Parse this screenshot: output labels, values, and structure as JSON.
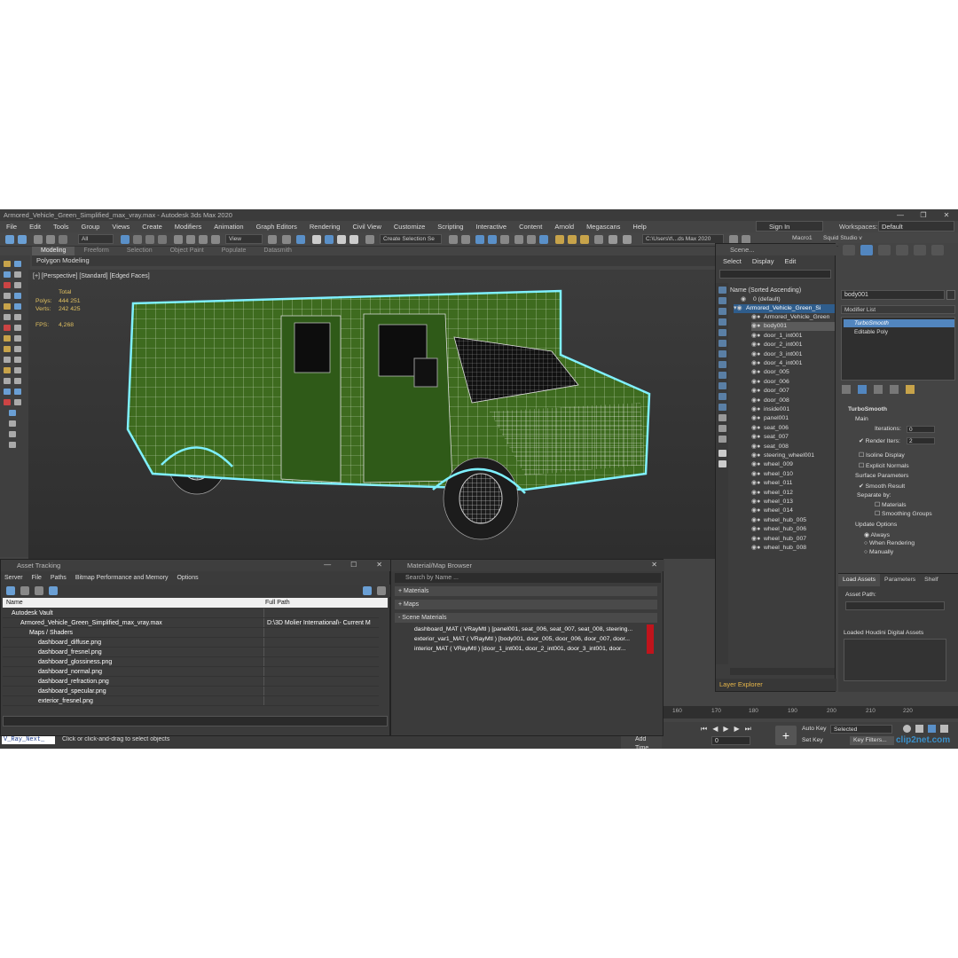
{
  "app": {
    "title": "Armored_Vehicle_Green_Simplified_max_vray.max - Autodesk 3ds Max 2020",
    "menu": [
      "File",
      "Edit",
      "Tools",
      "Group",
      "Views",
      "Create",
      "Modifiers",
      "Animation",
      "Graph Editors",
      "Rendering",
      "Civil View",
      "Customize",
      "Scripting",
      "Interactive",
      "Content",
      "Arnold",
      "Megascans",
      "Help"
    ],
    "sign_in": "Sign In",
    "workspaces_label": "Workspaces:",
    "workspaces_value": "Default",
    "toolbar": {
      "filter": "All",
      "ref_coord": "View",
      "selection_set": "Create Selection Se",
      "path": "C:\\Users\\t\\...ds Max 2020",
      "macro": "Macro1",
      "squid": "Squid Studio v"
    },
    "ribbon_tabs": [
      "Modeling",
      "Freeform",
      "Selection",
      "Object Paint",
      "Populate",
      "Datasmith"
    ],
    "ribbon_sub": "Polygon Modeling"
  },
  "viewport": {
    "label": "[+] [Perspective] [Standard] [Edged Faces]",
    "total": "Total",
    "polys_label": "Polys:",
    "polys_value": "444 251",
    "verts_label": "Verts:",
    "verts_value": "242 425",
    "fps_label": "FPS:",
    "fps_value": "4,268"
  },
  "scene_explorer": {
    "title": "Scene...",
    "menu": [
      "Select",
      "Display",
      "Edit"
    ],
    "column_header": "Name (Sorted Ascending)",
    "root": "0 (default)",
    "group": "Armored_Vehicle_Green_Si",
    "items": [
      "Armored_Vehicle_Green",
      "body001",
      "door_1_int001",
      "door_2_int001",
      "door_3_int001",
      "door_4_int001",
      "door_005",
      "door_006",
      "door_007",
      "door_008",
      "inside001",
      "panel001",
      "seat_006",
      "seat_007",
      "seat_008",
      "steering_wheel001",
      "wheel_009",
      "wheel_010",
      "wheel_011",
      "wheel_012",
      "wheel_013",
      "wheel_014",
      "wheel_hub_005",
      "wheel_hub_006",
      "wheel_hub_007",
      "wheel_hub_008"
    ],
    "footer": "Layer Explorer"
  },
  "command_panel": {
    "object_name": "body001",
    "modifier_list": "Modifier List",
    "stack": [
      "TurboSmooth",
      "Editable Poly"
    ],
    "rollout_title": "TurboSmooth",
    "main": "Main",
    "iterations_label": "Iterations:",
    "iterations_value": "0",
    "render_iters_label": "Render Iters:",
    "render_iters_value": "2",
    "isoline": "Isoline Display",
    "explicit": "Explicit Normals",
    "surface_params": "Surface Parameters",
    "smooth_result": "Smooth Result",
    "separate_by": "Separate by:",
    "materials": "Materials",
    "smoothing_groups": "Smoothing Groups",
    "update_options": "Update Options",
    "always": "Always",
    "when_rendering": "When Rendering",
    "manually": "Manually"
  },
  "bottom_panel": {
    "tabs": [
      "Load Assets",
      "Parameters",
      "Shelf"
    ],
    "asset_path": "Asset Path:",
    "loaded": "Loaded Houdini Digital Assets"
  },
  "asset_tracking": {
    "title": "Asset Tracking",
    "menu": [
      "Server",
      "File",
      "Paths",
      "Bitmap Performance and Memory",
      "Options"
    ],
    "col_name": "Name",
    "col_path": "Full Path",
    "rows": [
      {
        "name": "Autodesk Vault",
        "path": "",
        "indent": 1
      },
      {
        "name": "Armored_Vehicle_Green_Simplified_max_vray.max",
        "path": "D:\\3D Molier International\\- Current M",
        "indent": 2
      },
      {
        "name": "Maps / Shaders",
        "path": "",
        "indent": 3
      },
      {
        "name": "dashboard_diffuse.png",
        "path": "",
        "indent": 4
      },
      {
        "name": "dashboard_fresnel.png",
        "path": "",
        "indent": 4
      },
      {
        "name": "dashboard_glossiness.png",
        "path": "",
        "indent": 4
      },
      {
        "name": "dashboard_normal.png",
        "path": "",
        "indent": 4
      },
      {
        "name": "dashboard_refraction.png",
        "path": "",
        "indent": 4
      },
      {
        "name": "dashboard_specular.png",
        "path": "",
        "indent": 4
      },
      {
        "name": "exterior_fresnel.png",
        "path": "",
        "indent": 4
      }
    ]
  },
  "material_browser": {
    "title": "Material/Map Browser",
    "search": "Search by Name ...",
    "sections": [
      "+ Materials",
      "+ Maps",
      "- Scene Materials"
    ],
    "materials": [
      "dashboard_MAT ( VRayMtl ) [panel001, seat_006, seat_007, seat_008, steering...",
      "exterior_var1_MAT ( VRayMtl ) [body001, door_005, door_006, door_007, door...",
      "interior_MAT ( VRayMtl ) [door_1_int001, door_2_int001, door_3_int001, door..."
    ]
  },
  "status": {
    "maxscript": "V_Ray_Next_",
    "prompt": "Click or click-and-drag to select objects",
    "add_time_tag": "Add Time Tag",
    "auto_key": "Auto Key",
    "selected": "Selected",
    "set_key": "Set Key",
    "key_filters": "Key Filters...",
    "frame": "0",
    "time_ticks": [
      "160",
      "170",
      "180",
      "190",
      "200",
      "210",
      "220"
    ]
  },
  "watermark": "clip2net.com",
  "colors": {
    "accent": "#5286bf",
    "wire": "#7ef0ff",
    "body": "#3e6b1f",
    "material_flag": "#c0141c"
  }
}
